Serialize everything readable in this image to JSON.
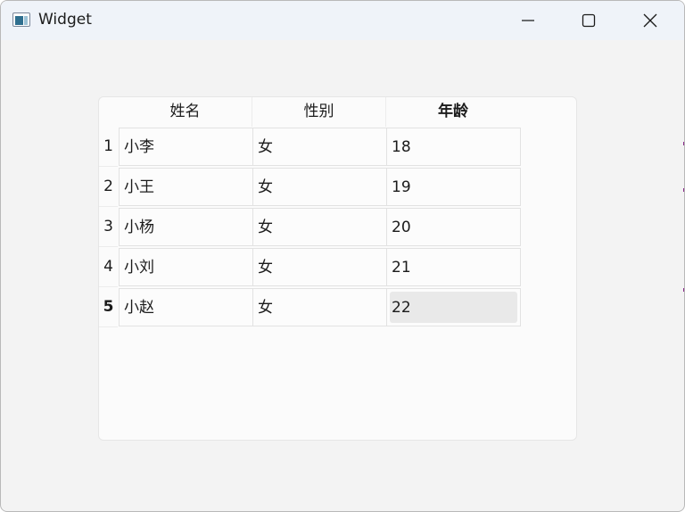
{
  "window": {
    "title": "Widget",
    "icon": "widget-app-icon",
    "controls": [
      "minimize-icon",
      "maximize-icon",
      "close-icon"
    ]
  },
  "table": {
    "columns": [
      "姓名",
      "性别",
      "年龄"
    ],
    "row_headers": [
      "1",
      "2",
      "3",
      "4",
      "5"
    ],
    "rows": [
      [
        "小李",
        "女",
        "18"
      ],
      [
        "小王",
        "女",
        "19"
      ],
      [
        "小杨",
        "女",
        "20"
      ],
      [
        "小刘",
        "女",
        "21"
      ],
      [
        "小赵",
        "女",
        "22"
      ]
    ],
    "selected": {
      "row": 5,
      "column": 3
    }
  }
}
